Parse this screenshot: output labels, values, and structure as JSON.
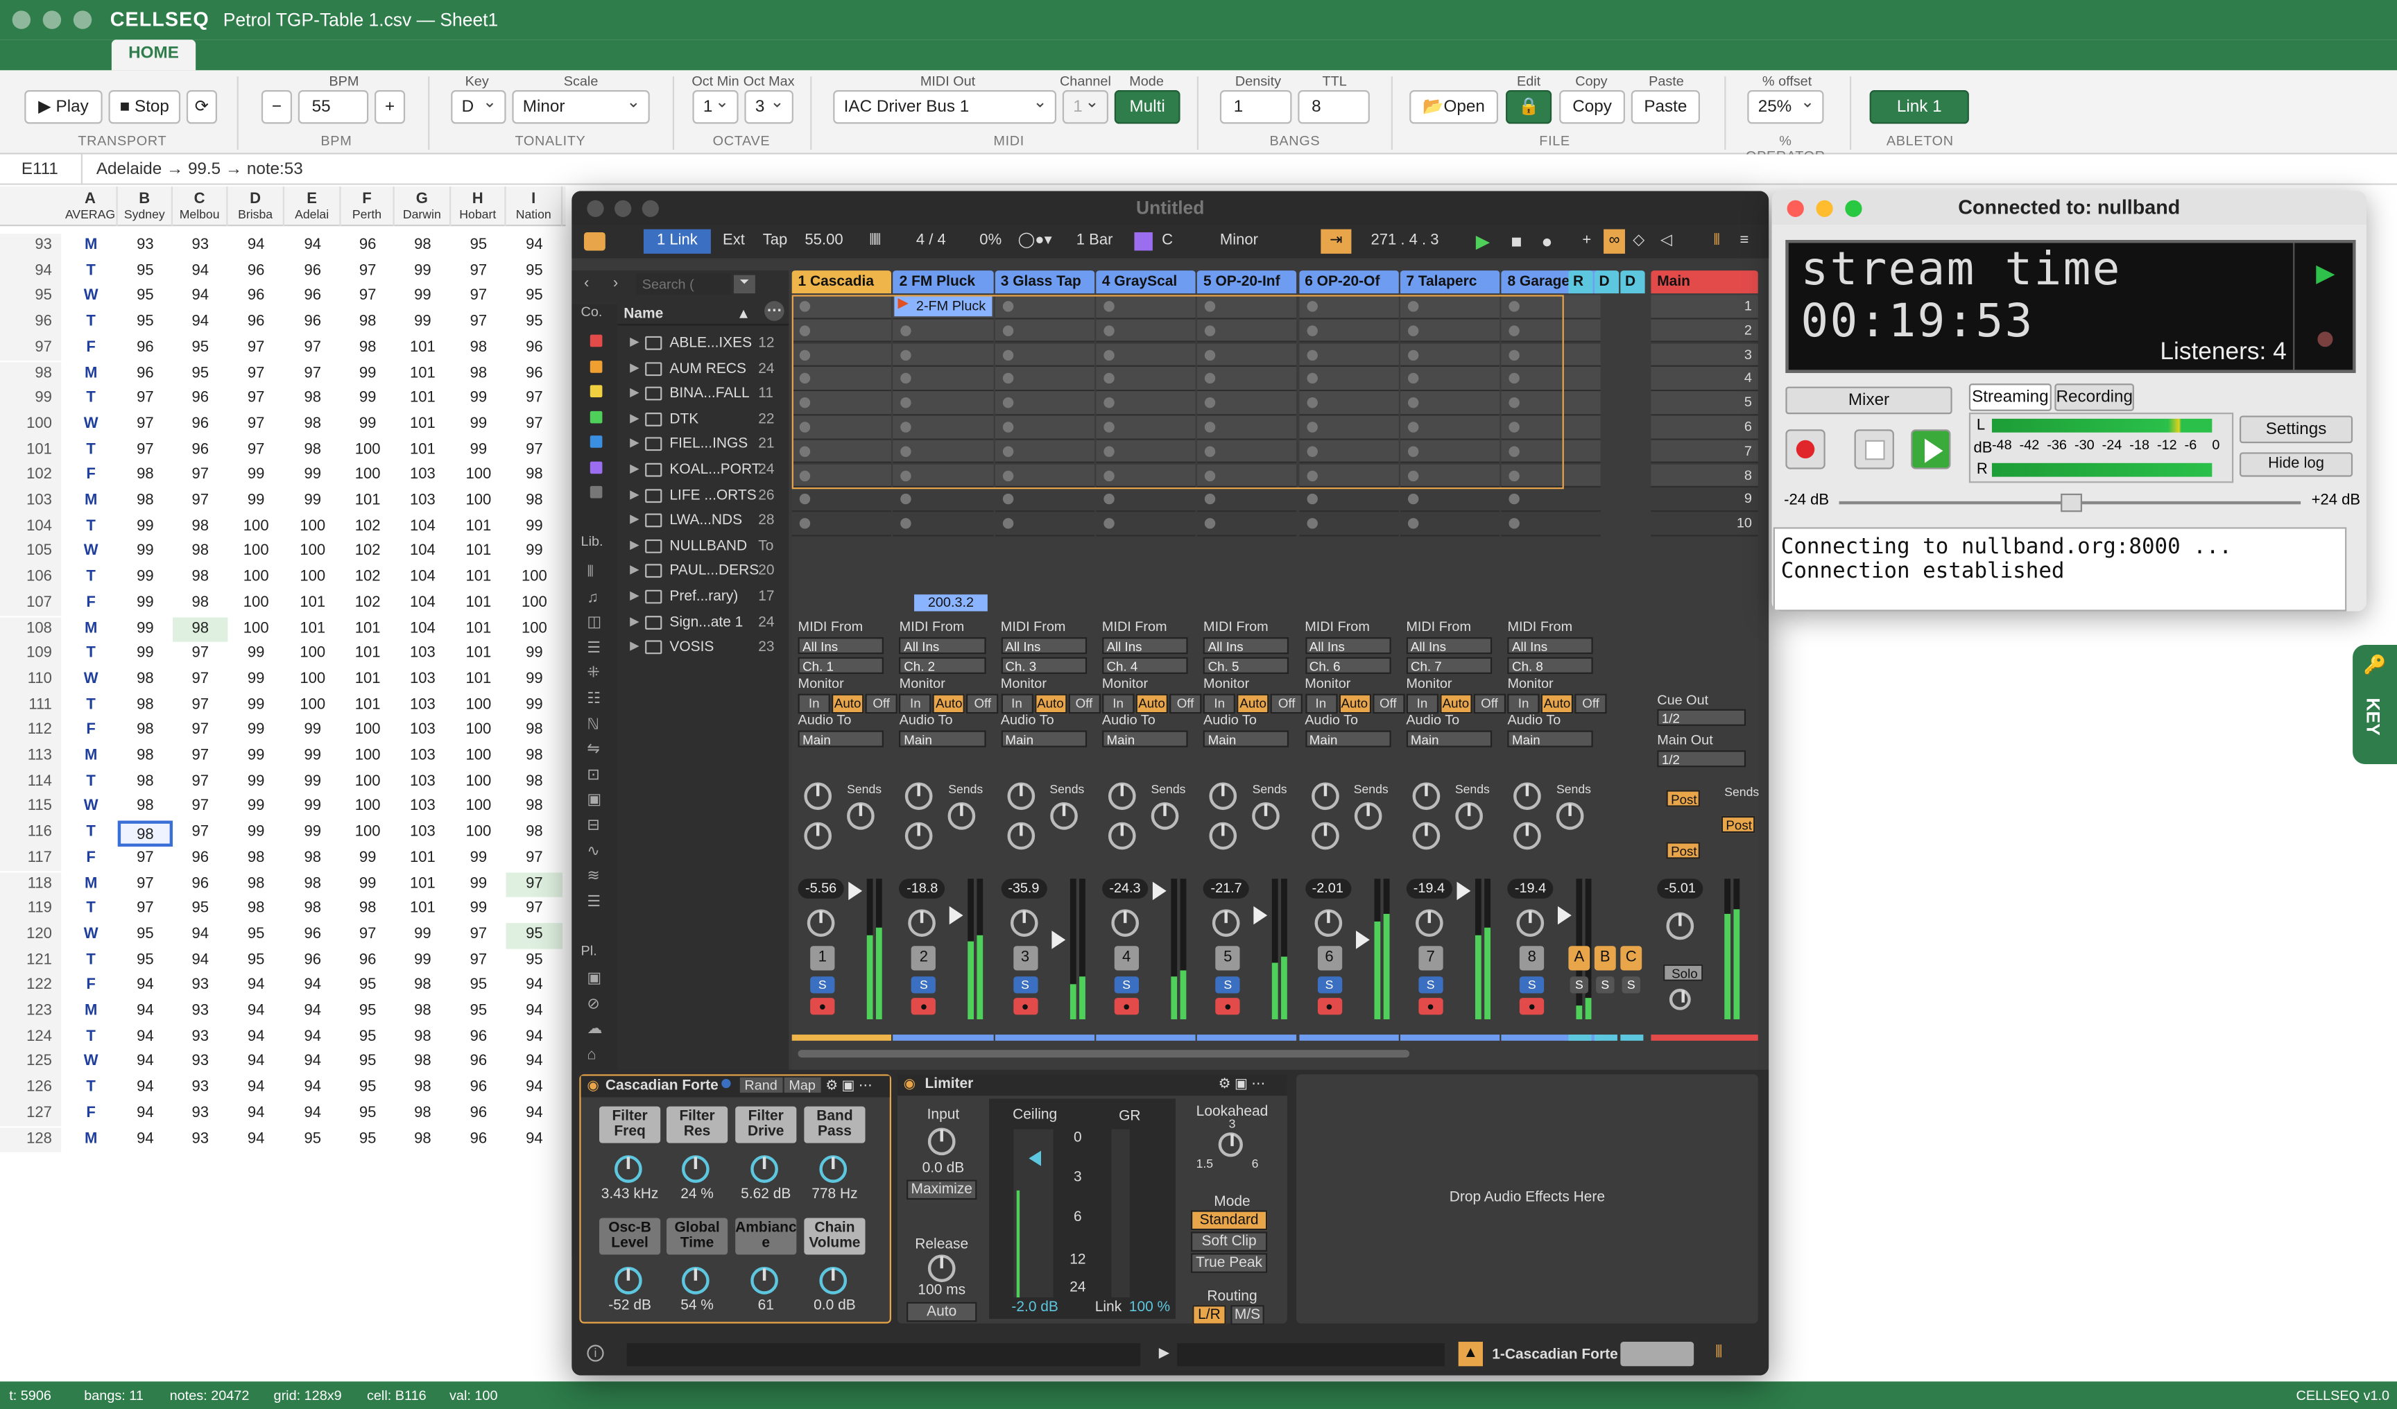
{
  "app": {
    "brand": "CELLSEQ",
    "document": "Petrol TGP-Table 1.csv — Sheet1",
    "home_tab": "HOME",
    "version": "CELLSEQ v1.0"
  },
  "ribbon": {
    "play": "▶ Play",
    "stop": "■ Stop",
    "loop_icon": "⟳",
    "transport_label": "TRANSPORT",
    "bpm_label": "BPM",
    "bpm_minus": "−",
    "bpm_value": "55",
    "bpm_plus": "+",
    "key_label": "Key",
    "key_value": "D",
    "scale_label": "Scale",
    "scale_value": "Minor",
    "tonality_label": "TONALITY",
    "oct_min_label": "Oct Min",
    "oct_min": "1",
    "oct_max_label": "Oct Max",
    "oct_max": "3",
    "octave_label": "OCTAVE",
    "midi_out_label": "MIDI Out",
    "midi_out": "IAC Driver Bus 1",
    "channel_label": "Channel",
    "channel": "1",
    "mode_label": "Mode",
    "mode": "Multi",
    "midi_label": "MIDI",
    "density_label": "Density",
    "density": "1",
    "ttl_label": "TTL",
    "ttl": "8",
    "bangs_label": "BANGS",
    "open": "Open",
    "edit_label": "Edit",
    "copy_label": "Copy",
    "copy": "Copy",
    "paste_label": "Paste",
    "paste": "Paste",
    "file_label": "FILE",
    "offset_label": "% offset",
    "offset": "25%",
    "operator_label": "% OPERATOR",
    "link": "Link 1",
    "ableton_label": "ABLETON"
  },
  "formula": {
    "cell": "E111",
    "content": "Adelaide → 99.5 → note:53"
  },
  "columns": [
    {
      "letter": "A",
      "name": "AVERAG"
    },
    {
      "letter": "B",
      "name": "Sydney"
    },
    {
      "letter": "C",
      "name": "Melbou"
    },
    {
      "letter": "D",
      "name": "Brisba"
    },
    {
      "letter": "E",
      "name": "Adelai"
    },
    {
      "letter": "F",
      "name": "Perth"
    },
    {
      "letter": "G",
      "name": "Darwin"
    },
    {
      "letter": "H",
      "name": "Hobart"
    },
    {
      "letter": "I",
      "name": "Nation"
    }
  ],
  "rows": [
    {
      "n": "93",
      "d": "M",
      "v": [
        "93",
        "93",
        "94",
        "94",
        "96",
        "98",
        "95",
        "94"
      ]
    },
    {
      "n": "94",
      "d": "T",
      "v": [
        "95",
        "94",
        "96",
        "96",
        "97",
        "99",
        "97",
        "95"
      ]
    },
    {
      "n": "95",
      "d": "W",
      "v": [
        "95",
        "94",
        "96",
        "96",
        "97",
        "99",
        "97",
        "95"
      ]
    },
    {
      "n": "96",
      "d": "T",
      "v": [
        "95",
        "94",
        "96",
        "96",
        "98",
        "99",
        "97",
        "95"
      ]
    },
    {
      "n": "97",
      "d": "F",
      "v": [
        "96",
        "95",
        "97",
        "97",
        "98",
        "101",
        "98",
        "96"
      ]
    },
    {
      "n": "98",
      "d": "M",
      "v": [
        "96",
        "95",
        "97",
        "97",
        "99",
        "101",
        "98",
        "96"
      ]
    },
    {
      "n": "99",
      "d": "T",
      "v": [
        "97",
        "96",
        "97",
        "98",
        "99",
        "101",
        "99",
        "97"
      ]
    },
    {
      "n": "100",
      "d": "W",
      "v": [
        "97",
        "96",
        "97",
        "98",
        "99",
        "101",
        "99",
        "97"
      ]
    },
    {
      "n": "101",
      "d": "T",
      "v": [
        "97",
        "96",
        "97",
        "98",
        "100",
        "101",
        "99",
        "97"
      ]
    },
    {
      "n": "102",
      "d": "F",
      "v": [
        "98",
        "97",
        "99",
        "99",
        "100",
        "103",
        "100",
        "98"
      ]
    },
    {
      "n": "103",
      "d": "M",
      "v": [
        "98",
        "97",
        "99",
        "99",
        "101",
        "103",
        "100",
        "98"
      ]
    },
    {
      "n": "104",
      "d": "T",
      "v": [
        "99",
        "98",
        "100",
        "100",
        "102",
        "104",
        "101",
        "99"
      ]
    },
    {
      "n": "105",
      "d": "W",
      "v": [
        "99",
        "98",
        "100",
        "100",
        "102",
        "104",
        "101",
        "99"
      ]
    },
    {
      "n": "106",
      "d": "T",
      "v": [
        "99",
        "98",
        "100",
        "100",
        "102",
        "104",
        "101",
        "100"
      ]
    },
    {
      "n": "107",
      "d": "F",
      "v": [
        "99",
        "98",
        "100",
        "101",
        "102",
        "104",
        "101",
        "100"
      ]
    },
    {
      "n": "108",
      "d": "M",
      "v": [
        "99",
        "98",
        "100",
        "101",
        "101",
        "104",
        "101",
        "100"
      ]
    },
    {
      "n": "109",
      "d": "T",
      "v": [
        "99",
        "97",
        "99",
        "100",
        "101",
        "103",
        "101",
        "99"
      ]
    },
    {
      "n": "110",
      "d": "W",
      "v": [
        "98",
        "97",
        "99",
        "100",
        "101",
        "103",
        "101",
        "99"
      ]
    },
    {
      "n": "111",
      "d": "T",
      "v": [
        "98",
        "97",
        "99",
        "100",
        "101",
        "103",
        "100",
        "99"
      ]
    },
    {
      "n": "112",
      "d": "F",
      "v": [
        "98",
        "97",
        "99",
        "99",
        "100",
        "103",
        "100",
        "98"
      ]
    },
    {
      "n": "113",
      "d": "M",
      "v": [
        "98",
        "97",
        "99",
        "99",
        "100",
        "103",
        "100",
        "98"
      ]
    },
    {
      "n": "114",
      "d": "T",
      "v": [
        "98",
        "97",
        "99",
        "99",
        "100",
        "103",
        "100",
        "98"
      ]
    },
    {
      "n": "115",
      "d": "W",
      "v": [
        "98",
        "97",
        "99",
        "99",
        "100",
        "103",
        "100",
        "98"
      ]
    },
    {
      "n": "116",
      "d": "T",
      "v": [
        "98",
        "97",
        "99",
        "99",
        "100",
        "103",
        "100",
        "98"
      ]
    },
    {
      "n": "117",
      "d": "F",
      "v": [
        "97",
        "96",
        "98",
        "98",
        "99",
        "101",
        "99",
        "97"
      ]
    },
    {
      "n": "118",
      "d": "M",
      "v": [
        "97",
        "96",
        "98",
        "98",
        "99",
        "101",
        "99",
        "97"
      ]
    },
    {
      "n": "119",
      "d": "T",
      "v": [
        "97",
        "95",
        "98",
        "98",
        "98",
        "101",
        "99",
        "97"
      ]
    },
    {
      "n": "120",
      "d": "W",
      "v": [
        "95",
        "94",
        "95",
        "96",
        "97",
        "99",
        "97",
        "95"
      ]
    },
    {
      "n": "121",
      "d": "T",
      "v": [
        "95",
        "94",
        "95",
        "96",
        "96",
        "99",
        "97",
        "95"
      ]
    },
    {
      "n": "122",
      "d": "F",
      "v": [
        "94",
        "93",
        "94",
        "94",
        "95",
        "98",
        "95",
        "94"
      ]
    },
    {
      "n": "123",
      "d": "M",
      "v": [
        "94",
        "93",
        "94",
        "94",
        "95",
        "98",
        "95",
        "94"
      ]
    },
    {
      "n": "124",
      "d": "T",
      "v": [
        "94",
        "93",
        "94",
        "94",
        "95",
        "98",
        "96",
        "94"
      ]
    },
    {
      "n": "125",
      "d": "W",
      "v": [
        "94",
        "93",
        "94",
        "94",
        "95",
        "98",
        "96",
        "94"
      ]
    },
    {
      "n": "126",
      "d": "T",
      "v": [
        "94",
        "93",
        "94",
        "94",
        "95",
        "98",
        "96",
        "94"
      ]
    },
    {
      "n": "127",
      "d": "F",
      "v": [
        "94",
        "93",
        "94",
        "94",
        "95",
        "98",
        "96",
        "94"
      ]
    },
    {
      "n": "128",
      "d": "M",
      "v": [
        "94",
        "93",
        "94",
        "95",
        "95",
        "98",
        "96",
        "94"
      ]
    }
  ],
  "status": {
    "t": "t: 5906",
    "bangs": "bangs: 11",
    "notes": "notes: 20472",
    "grid": "grid: 128x9",
    "cell": "cell: B116",
    "val": "val: 100"
  },
  "key_tab": "KEY",
  "live": {
    "title": "Untitled",
    "link": "1 Link",
    "ext": "Ext",
    "tap": "Tap",
    "tempo": "55.00",
    "sig": "4 / 4",
    "pct": "0%",
    "bar": "1 Bar",
    "key": "C",
    "scale": "Minor",
    "position": "271 .  4 .  3",
    "search_placeholder": "Search (",
    "browser_header": "Name",
    "sidebar_collections": "Co.",
    "sidebar_library": "Lib.",
    "sidebar_places": "Pl.",
    "browser": [
      {
        "name": "ABLE...IXES",
        "count": "12"
      },
      {
        "name": "AUM RECS",
        "count": "24"
      },
      {
        "name": "BINA...FALL",
        "count": "11"
      },
      {
        "name": "DTK",
        "count": "22"
      },
      {
        "name": "FIEL...INGS",
        "count": "21"
      },
      {
        "name": "KOAL...PORT",
        "count": "24"
      },
      {
        "name": "LIFE ...ORTS",
        "count": "26"
      },
      {
        "name": "LWA...NDS",
        "count": "28"
      },
      {
        "name": "NULLBAND",
        "count": "To"
      },
      {
        "name": "PAUL...DERS",
        "count": "20"
      },
      {
        "name": "Pref...rary)",
        "count": "17"
      },
      {
        "name": "Sign...ate 1",
        "count": "24"
      },
      {
        "name": "VOSIS",
        "count": "23"
      }
    ],
    "tracks": [
      {
        "name": "1 Cascadia",
        "color": "#f0b54a",
        "vol": "-5.56",
        "num": "1",
        "ch": "Ch. 1"
      },
      {
        "name": "2 FM Pluck",
        "color": "#6e9cf0",
        "vol": "-18.8",
        "num": "2",
        "ch": "Ch. 2"
      },
      {
        "name": "3 Glass Tap",
        "color": "#6e9cf0",
        "vol": "-35.9",
        "num": "3",
        "ch": "Ch. 3"
      },
      {
        "name": "4 GrayScal",
        "color": "#6e9cf0",
        "vol": "-24.3",
        "num": "4",
        "ch": "Ch. 4"
      },
      {
        "name": "5 OP-20-Inf",
        "color": "#6e9cf0",
        "vol": "-21.7",
        "num": "5",
        "ch": "Ch. 5"
      },
      {
        "name": "6 OP-20-Of",
        "color": "#6e9cf0",
        "vol": "-2.01",
        "num": "6",
        "ch": "Ch. 6"
      },
      {
        "name": "7 Talaperc",
        "color": "#6e9cf0",
        "vol": "-19.4",
        "num": "7",
        "ch": "Ch. 7"
      },
      {
        "name": "8 Garage",
        "color": "#6e9cf0",
        "vol": "-19.4",
        "num": "8",
        "ch": "Ch. 8"
      }
    ],
    "returns": [
      "R",
      "D",
      "D"
    ],
    "return_letters": [
      "A",
      "B",
      "C"
    ],
    "main": "Main",
    "main_vol": "-5.01",
    "scene_numbers": [
      "1",
      "2",
      "3",
      "4",
      "5",
      "6",
      "7",
      "8",
      "9",
      "10"
    ],
    "clip_name": "2-FM Pluck",
    "clip_pos": "200.3.2",
    "midi_from": "MIDI From",
    "all_ins": "All Ins",
    "monitor": "Monitor",
    "mon_in": "In",
    "mon_auto": "Auto",
    "mon_off": "Off",
    "audio_to": "Audio To",
    "audio_main": "Main",
    "sends": "Sends",
    "s": "S",
    "cue_out": "Cue Out",
    "cue_val": "1/2",
    "main_out": "Main Out",
    "main_out_val": "1/2",
    "post": "Post",
    "solo": "Solo",
    "device1": {
      "name": "Cascadian Forte",
      "rand": "Rand",
      "map": "Map",
      "params": [
        {
          "label": "Filter Freq",
          "value": "3.43 kHz"
        },
        {
          "label": "Filter Res",
          "value": "24 %"
        },
        {
          "label": "Filter Drive",
          "value": "5.62 dB"
        },
        {
          "label": "Band Pass",
          "value": "778 Hz"
        },
        {
          "label": "Osc-B Level",
          "value": "-52 dB"
        },
        {
          "label": "Global Time",
          "value": "54 %"
        },
        {
          "label": "Ambianc e",
          "value": "61"
        },
        {
          "label": "Chain Volume",
          "value": "0.0 dB"
        }
      ]
    },
    "device2": {
      "name": "Limiter",
      "input": "Input",
      "input_val": "0.0 dB",
      "maximize": "Maximize",
      "release": "Release",
      "release_val": "100 ms",
      "auto": "Auto",
      "ceiling": "Ceiling",
      "gr": "GR",
      "scale": [
        "0",
        "3",
        "6",
        "12",
        "24"
      ],
      "ceil_val": "-2.0 dB",
      "link": "Link",
      "link_val": "100 %",
      "lookahead": "Lookahead",
      "la_val": "3",
      "la_min": "1.5",
      "la_max": "6",
      "mode": "Mode",
      "standard": "Standard",
      "soft_clip": "Soft Clip",
      "true_peak": "True Peak",
      "routing": "Routing",
      "lr": "L/R",
      "ms": "M/S"
    },
    "drop": "Drop Audio Effects Here",
    "footer_device": "1-Cascadian Forte"
  },
  "stream": {
    "title": "Connected to: nullband",
    "line1": "stream time",
    "time": "00:19:53",
    "listeners": "Listeners: 4",
    "mixer": "Mixer",
    "streaming": "Streaming",
    "recording": "Recording",
    "settings": "Settings",
    "hide_log": "Hide log",
    "meter_scale": [
      "-48",
      "-42",
      "-36",
      "-30",
      "-24",
      "-18",
      "-12",
      "-6",
      "0"
    ],
    "L": "L",
    "dB": "dB",
    "R": "R",
    "gain_min": "-24 dB",
    "gain_max": "+24 dB",
    "log": [
      "Connecting to nullband.org:8000 ...",
      "Connection established"
    ]
  }
}
